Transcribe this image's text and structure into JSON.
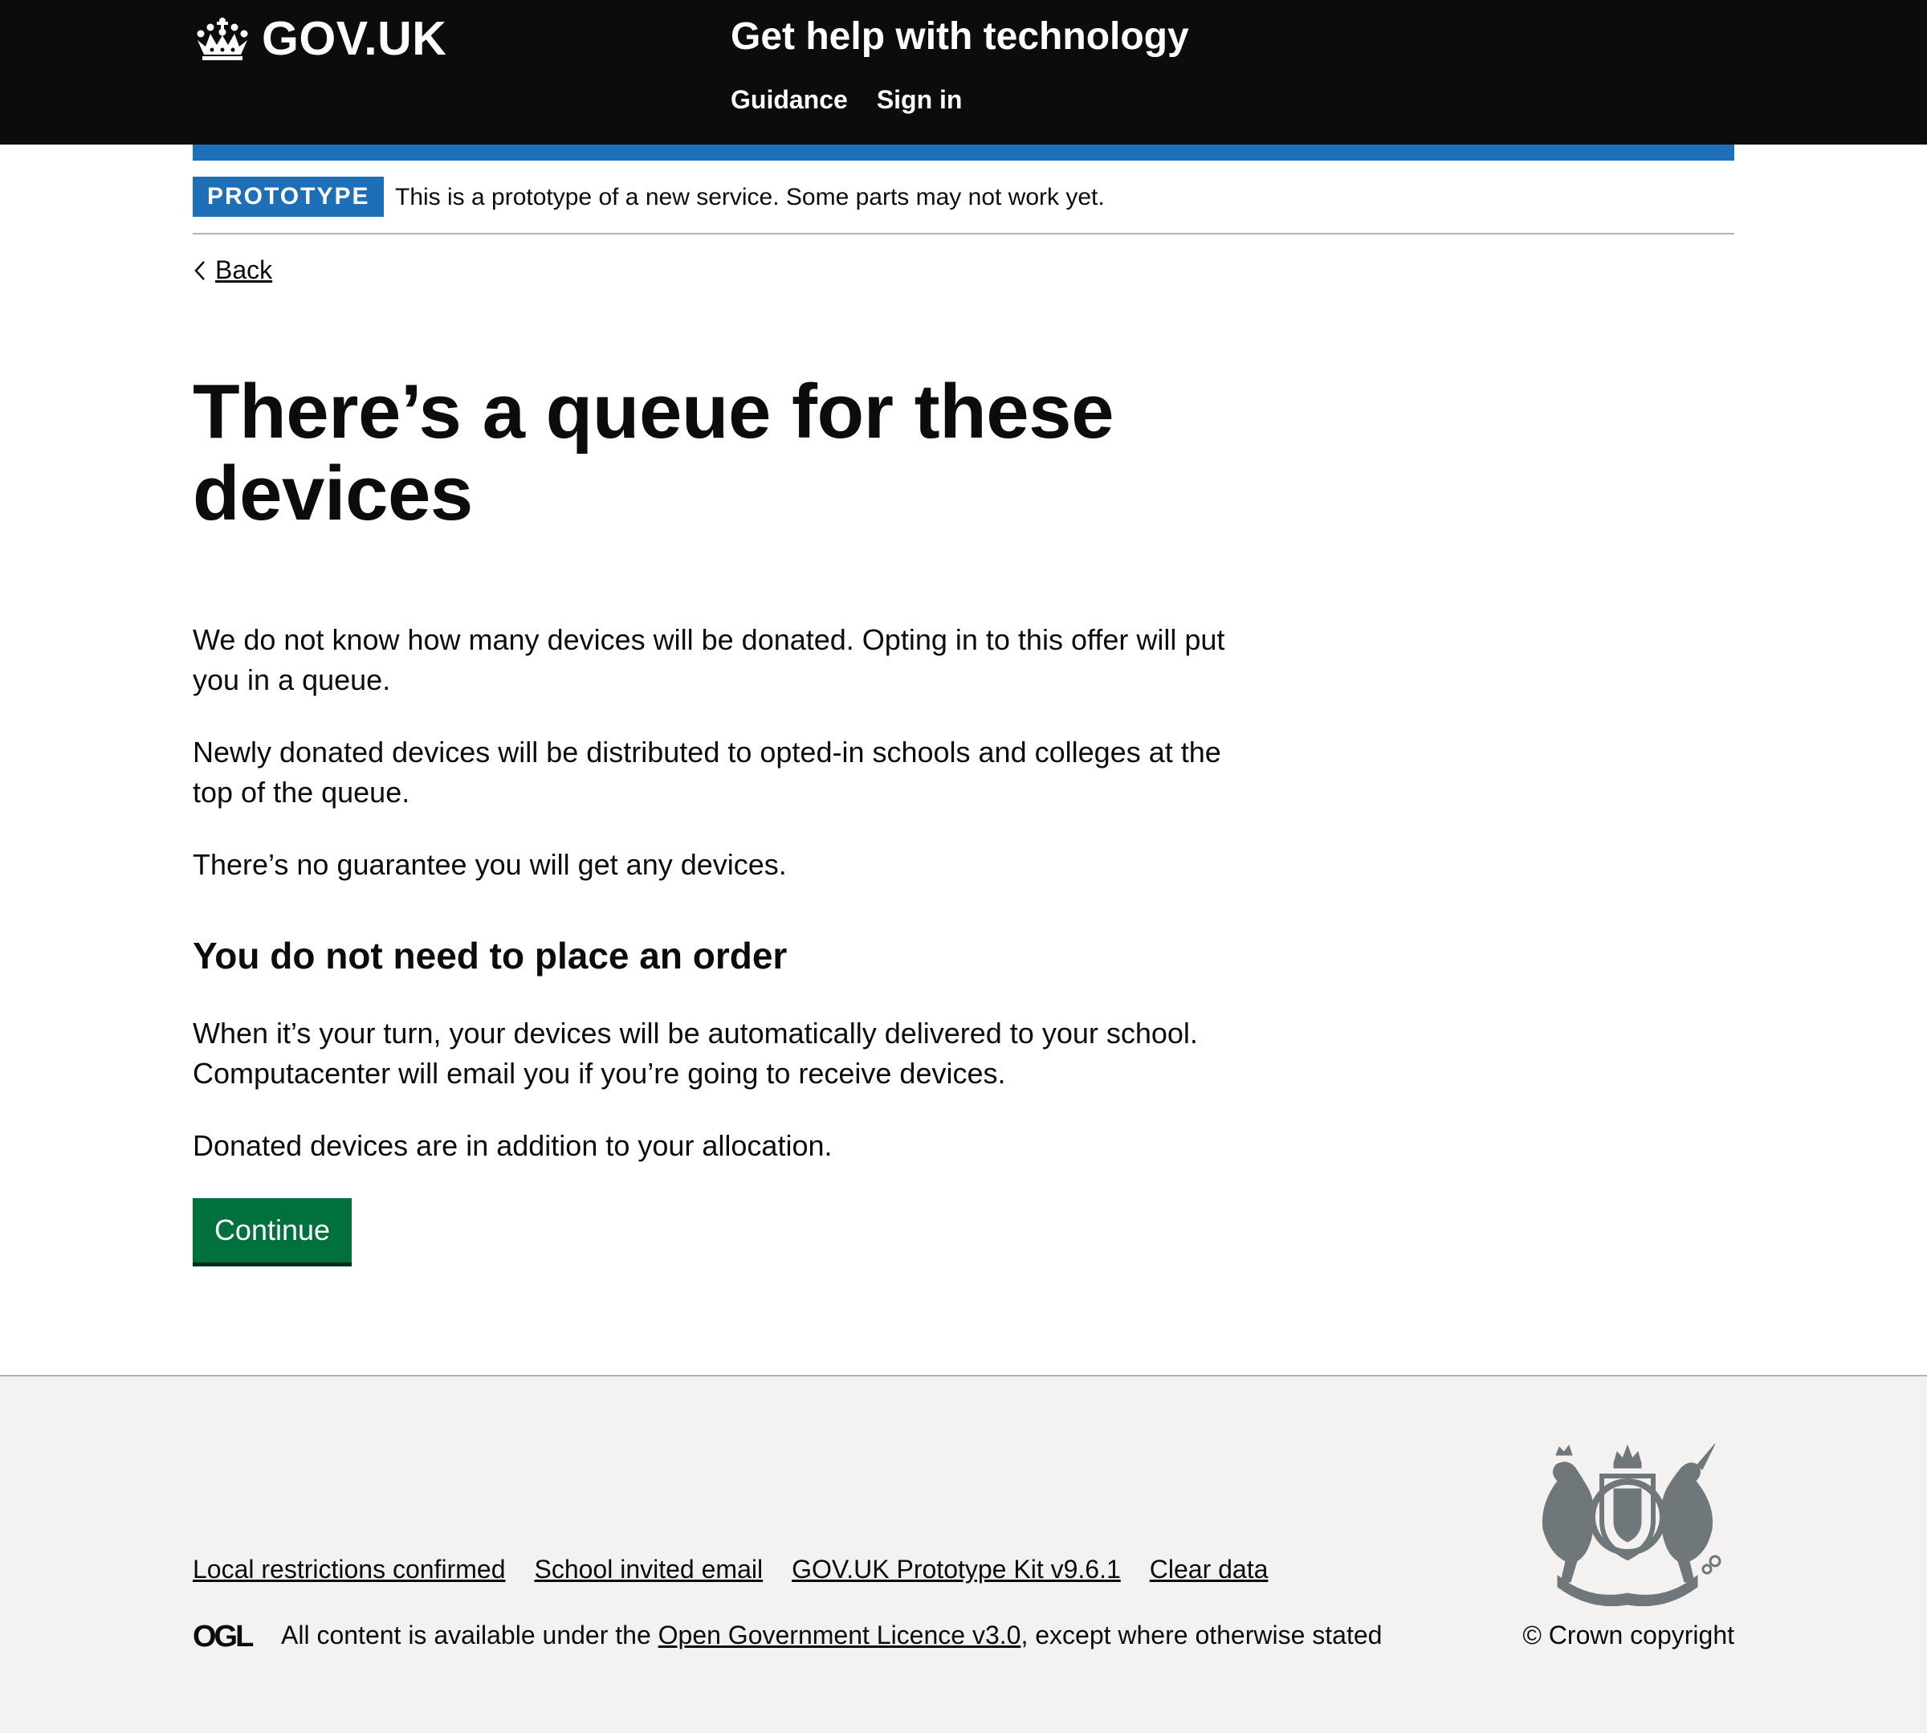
{
  "header": {
    "logo_text": "GOV.UK",
    "service_name": "Get help with technology",
    "nav": [
      {
        "label": "Guidance"
      },
      {
        "label": "Sign in"
      }
    ]
  },
  "phase_banner": {
    "tag": "PROTOTYPE",
    "text": "This is a prototype of a new service. Some parts may not work yet."
  },
  "back_link": "Back",
  "main": {
    "title": "There’s a queue for these devices",
    "paragraphs": [
      "We do not know how many devices will be donated. Opting in to this offer will put you in a queue.",
      "Newly donated devices will be distributed to opted-in schools and colleges at the top of the queue.",
      "There’s no guarantee you will get any devices."
    ],
    "subheading": "You do not need to place an order",
    "paragraphs_2": [
      "When it’s your turn, your devices will be automatically delivered to your school. Computacenter will email you if you’re going to receive devices.",
      "Donated devices are in addition to your allocation."
    ],
    "continue_button": "Continue"
  },
  "footer": {
    "links": [
      {
        "label": "Local restrictions confirmed"
      },
      {
        "label": "School invited email"
      },
      {
        "label": "GOV.UK Prototype Kit v9.6.1"
      },
      {
        "label": "Clear data"
      }
    ],
    "licence_prefix": "All content is available under the ",
    "licence_link": "Open Government Licence v3.0",
    "licence_suffix": ", except where otherwise stated",
    "copyright": "© Crown copyright",
    "ogl_logo_text": "OGL"
  },
  "colors": {
    "header_bg": "#0b0c0c",
    "brand_blue": "#1d70b8",
    "button_green": "#00703c",
    "footer_bg": "#f3f2f1"
  }
}
